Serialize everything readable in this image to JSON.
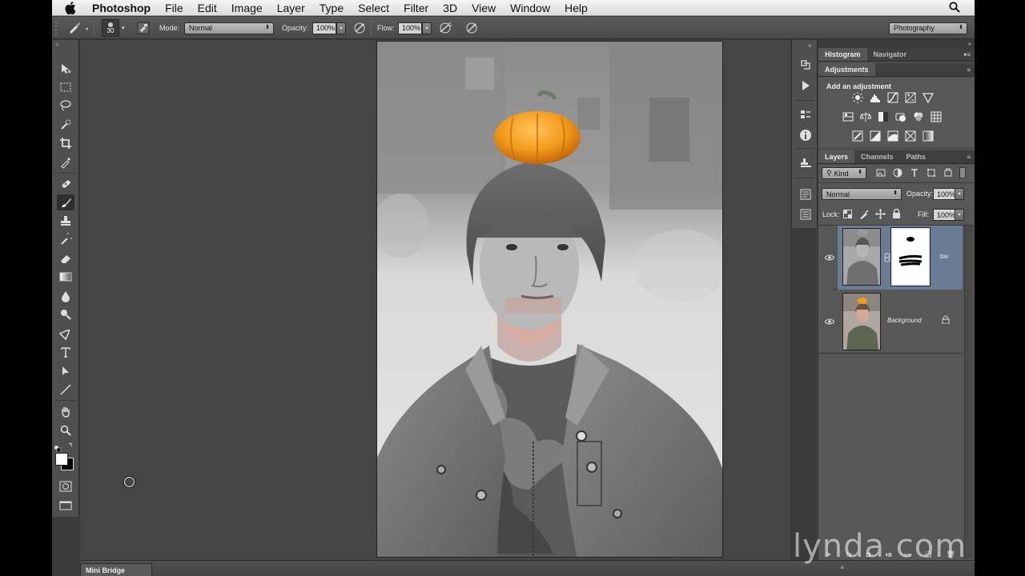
{
  "menubar": {
    "app_name": "Photoshop",
    "items": [
      "File",
      "Edit",
      "Image",
      "Layer",
      "Type",
      "Select",
      "Filter",
      "3D",
      "View",
      "Window",
      "Help"
    ]
  },
  "options_bar": {
    "brush_size": "30",
    "mode_label": "Mode:",
    "mode_value": "Normal",
    "opacity_label": "Opacity:",
    "opacity_value": "100%",
    "flow_label": "Flow:",
    "flow_value": "100%",
    "workspace": "Photography"
  },
  "bottom_bar": {
    "mini_bridge": "Mini Bridge"
  },
  "panels": {
    "top_tabs": [
      "Histogram",
      "Navigator"
    ],
    "adjustments_tab": "Adjustments",
    "add_adjustment": "Add an adjustment",
    "layers_tabs": [
      "Layers",
      "Channels",
      "Paths"
    ],
    "kind_filter": "Kind",
    "blend_mode": "Normal",
    "opacity_label": "Opacity:",
    "opacity_value": "100%",
    "lock_label": "Lock:",
    "fill_label": "Fill:",
    "fill_value": "100%",
    "layers": [
      {
        "name": "bw",
        "selected": true,
        "has_mask": true
      },
      {
        "name": "Background",
        "selected": false,
        "locked": true
      }
    ]
  },
  "watermark": "lynda.com",
  "colors": {
    "ui_dark": "#3b3b3b",
    "panel": "#575757",
    "selected_layer": "#6b7b94",
    "pumpkin": "#f39a1c"
  }
}
